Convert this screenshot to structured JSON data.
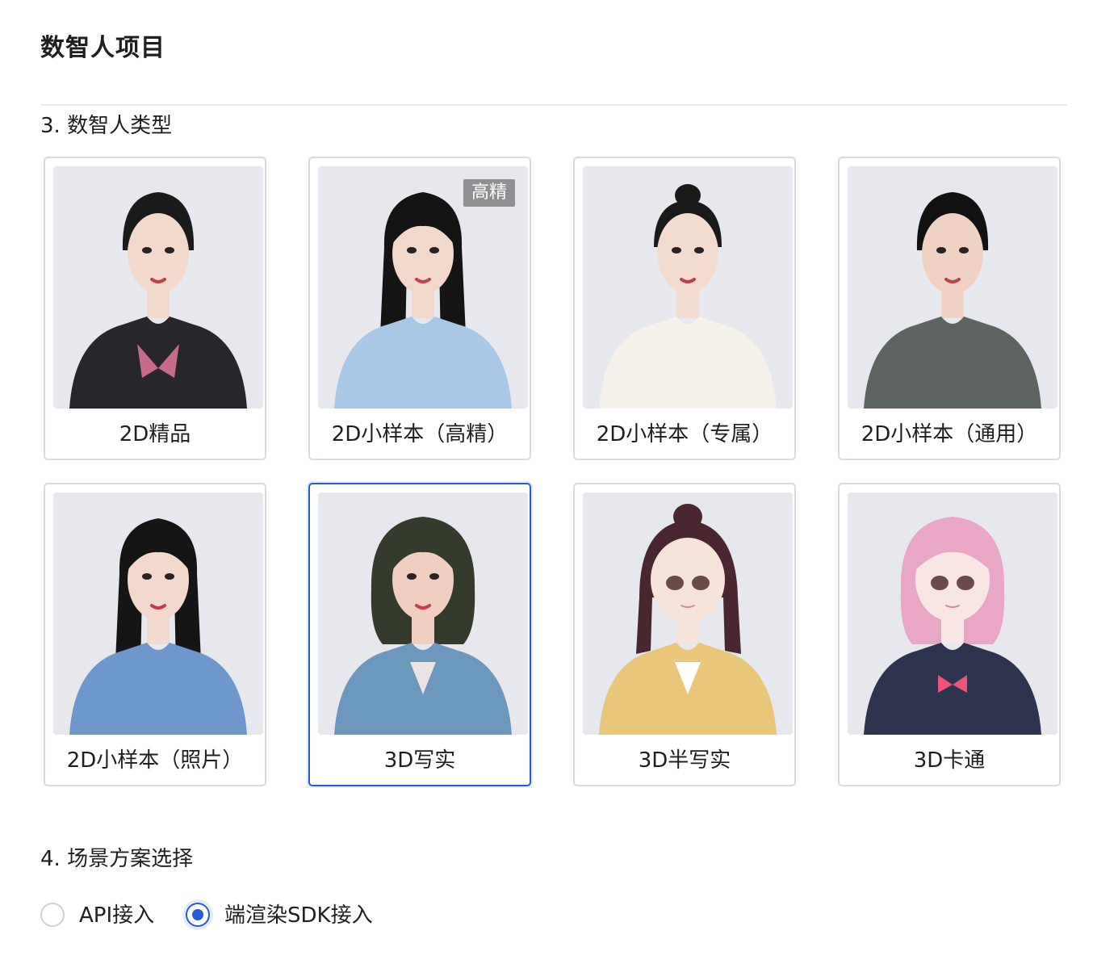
{
  "page": {
    "title": "数智人项目"
  },
  "section3": {
    "title": "3. 数智人类型",
    "cards": [
      {
        "label": "2D精品",
        "selected": false,
        "hair": "#1b1b1b",
        "outfit": "#26262b",
        "accent": "#ffffff",
        "skin": "#f3d9cc"
      },
      {
        "label": "2D小样本（高精）",
        "badge": "高精",
        "selected": false,
        "hair": "#141414",
        "outfit": "#a9c7e6",
        "accent": "#a9c7e6",
        "skin": "#f2d7cb"
      },
      {
        "label": "2D小样本（专属）",
        "selected": false,
        "hair": "#1a1a1a",
        "outfit": "#f4f1ea",
        "accent": "#f4f1ea",
        "skin": "#f4dbd0"
      },
      {
        "label": "2D小样本（通用）",
        "selected": false,
        "hair": "#121212",
        "outfit": "#5e6461",
        "accent": "#5e6461",
        "skin": "#efd2c4"
      },
      {
        "label": "2D小样本（照片）",
        "selected": false,
        "hair": "#151515",
        "outfit": "#6e97cc",
        "accent": "#6e97cc",
        "skin": "#f3d8cd"
      },
      {
        "label": "3D写实",
        "selected": true,
        "hair": "#343a2c",
        "outfit": "#6d98bd",
        "accent": "#e9e3e3",
        "skin": "#f0cfc0"
      },
      {
        "label": "3D半写实",
        "selected": false,
        "hair": "#4a2630",
        "outfit": "#e8c77a",
        "accent": "#ffffff",
        "skin": "#f6e3da"
      },
      {
        "label": "3D卡通",
        "selected": false,
        "hair": "#e9a7c6",
        "outfit": "#2e3350",
        "accent": "#f0527a",
        "skin": "#f8e6e4"
      }
    ]
  },
  "section4": {
    "title": "4. 场景方案选择",
    "options": [
      {
        "label": "API接入",
        "checked": false
      },
      {
        "label": "端渲染SDK接入",
        "checked": true
      }
    ]
  }
}
